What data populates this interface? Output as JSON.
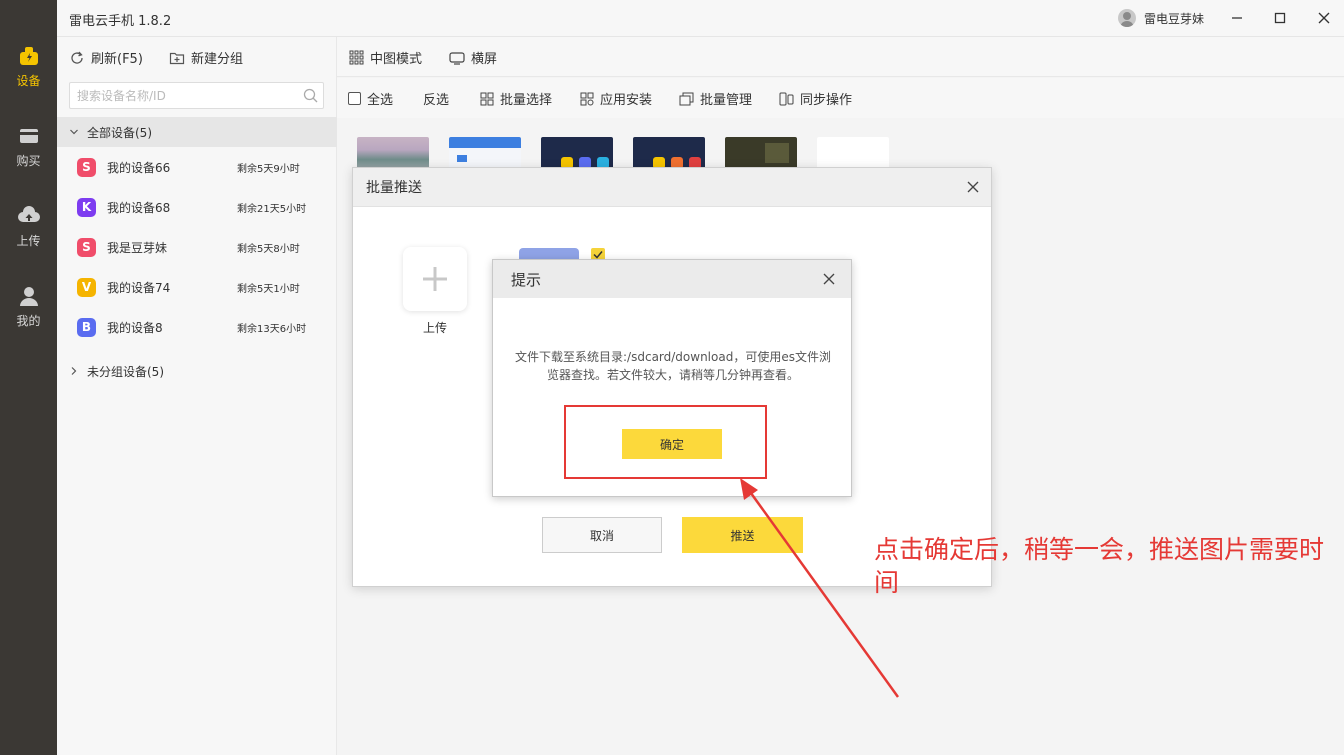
{
  "app": {
    "title": "雷电云手机 1.8.2",
    "username": "雷电豆芽妹"
  },
  "nav": {
    "items": [
      {
        "label": "设备",
        "icon": "device-icon",
        "active": true
      },
      {
        "label": "购买",
        "icon": "card-icon",
        "active": false
      },
      {
        "label": "上传",
        "icon": "cloud-upload-icon",
        "active": false
      },
      {
        "label": "我的",
        "icon": "user-icon",
        "active": false
      }
    ]
  },
  "devpanel": {
    "refresh_label": "刷新(F5)",
    "new_group_label": "新建分组",
    "search_placeholder": "搜索设备名称/ID",
    "all_group_label": "全部设备(5)",
    "ungrouped_label": "未分组设备(5)",
    "devices": [
      {
        "badge": "S",
        "color": "#f04d6a",
        "name": "我的设备66",
        "remain": "剩余5天9小时"
      },
      {
        "badge": "K",
        "color": "#7d3cf0",
        "name": "我的设备68",
        "remain": "剩余21天5小时"
      },
      {
        "badge": "S",
        "color": "#f04d6a",
        "name": "我是豆芽妹",
        "remain": "剩余5天8小时"
      },
      {
        "badge": "V",
        "color": "#f5b400",
        "name": "我的设备74",
        "remain": "剩余5天1小时"
      },
      {
        "badge": "B",
        "color": "#5a6cf0",
        "name": "我的设备8",
        "remain": "剩余13天6小时"
      }
    ]
  },
  "topbar": {
    "view_mode_label": "中图模式",
    "landscape_label": "横屏"
  },
  "secbar": {
    "select_all": "全选",
    "invert": "反选",
    "batch_select": "批量选择",
    "app_install": "应用安装",
    "batch_manage": "批量管理",
    "sync_op": "同步操作"
  },
  "batch_dialog": {
    "title": "批量推送",
    "upload_label": "上传",
    "cancel_label": "取消",
    "push_label": "推送"
  },
  "prompt_dialog": {
    "title": "提示",
    "message": "文件下载至系统目录:/sdcard/download，可使用es文件浏览器查找。若文件较大，请稍等几分钟再查看。",
    "ok_label": "确定"
  },
  "annotation": {
    "text": "点击确定后，稍等一会，推送图片需要时间",
    "color": "#e53935"
  },
  "colors": {
    "accent": "#fcd93b",
    "nav_bg": "#3b3834",
    "nav_active": "#f5c400"
  }
}
